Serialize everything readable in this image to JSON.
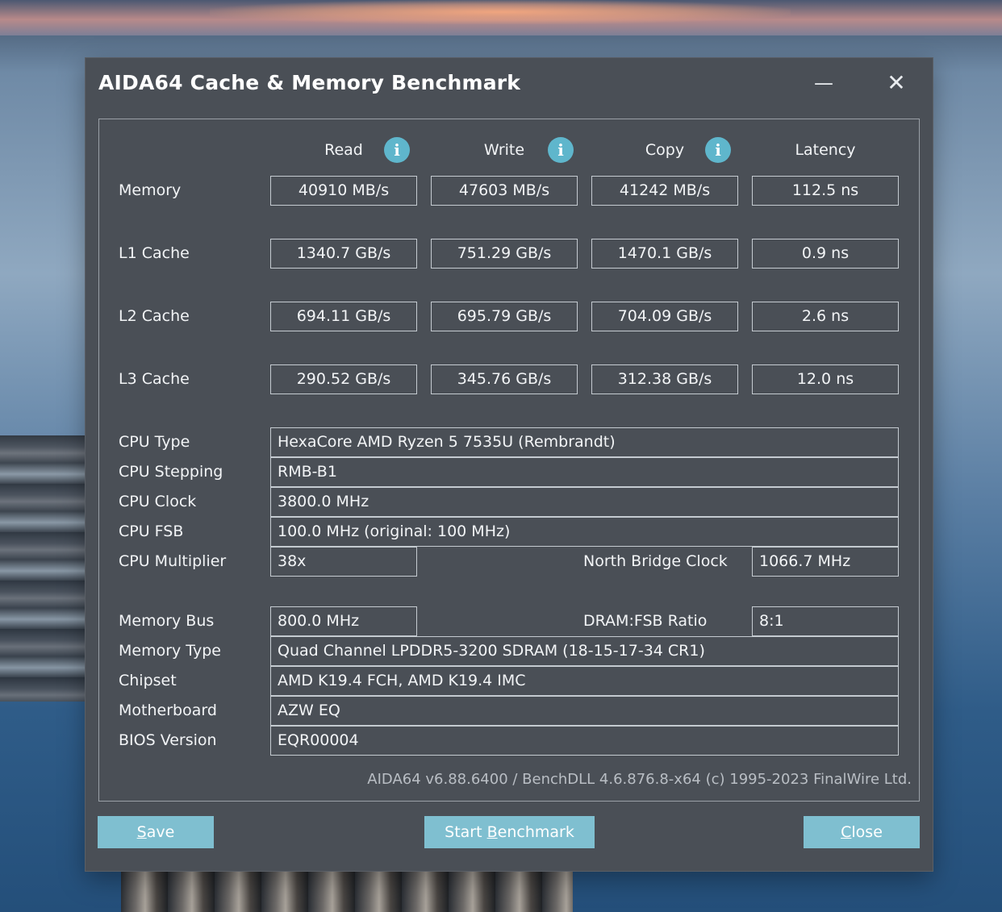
{
  "window": {
    "title": "AIDA64 Cache & Memory Benchmark",
    "minimize_glyph": "—",
    "close_glyph": "✕"
  },
  "columns": {
    "read": "Read",
    "write": "Write",
    "copy": "Copy",
    "latency": "Latency",
    "info_glyph": "i"
  },
  "rows": {
    "memory": {
      "label": "Memory",
      "read": "40910 MB/s",
      "write": "47603 MB/s",
      "copy": "41242 MB/s",
      "latency": "112.5 ns"
    },
    "l1": {
      "label": "L1 Cache",
      "read": "1340.7 GB/s",
      "write": "751.29 GB/s",
      "copy": "1470.1 GB/s",
      "latency": "0.9 ns"
    },
    "l2": {
      "label": "L2 Cache",
      "read": "694.11 GB/s",
      "write": "695.79 GB/s",
      "copy": "704.09 GB/s",
      "latency": "2.6 ns"
    },
    "l3": {
      "label": "L3 Cache",
      "read": "290.52 GB/s",
      "write": "345.76 GB/s",
      "copy": "312.38 GB/s",
      "latency": "12.0 ns"
    }
  },
  "info": {
    "cpu_type": {
      "label": "CPU Type",
      "value": "HexaCore AMD Ryzen 5 7535U  (Rembrandt)"
    },
    "cpu_stepping": {
      "label": "CPU Stepping",
      "value": "RMB-B1"
    },
    "cpu_clock": {
      "label": "CPU Clock",
      "value": "3800.0 MHz"
    },
    "cpu_fsb": {
      "label": "CPU FSB",
      "value": "100.0 MHz  (original: 100 MHz)"
    },
    "cpu_multiplier": {
      "label": "CPU Multiplier",
      "value": "38x"
    },
    "nb_clock": {
      "label": "North Bridge Clock",
      "value": "1066.7 MHz"
    },
    "memory_bus": {
      "label": "Memory Bus",
      "value": "800.0 MHz"
    },
    "dram_fsb": {
      "label": "DRAM:FSB Ratio",
      "value": "8:1"
    },
    "memory_type": {
      "label": "Memory Type",
      "value": "Quad Channel LPDDR5-3200 SDRAM  (18-15-17-34 CR1)"
    },
    "chipset": {
      "label": "Chipset",
      "value": "AMD K19.4 FCH, AMD K19.4 IMC"
    },
    "motherboard": {
      "label": "Motherboard",
      "value": "AZW EQ"
    },
    "bios": {
      "label": "BIOS Version",
      "value": "EQR00004"
    }
  },
  "footer": {
    "credit": "AIDA64 v6.88.6400 / BenchDLL 4.6.876.8-x64  (c) 1995-2023 FinalWire Ltd."
  },
  "buttons": {
    "save": {
      "pre": "",
      "key": "S",
      "post": "ave"
    },
    "start": {
      "pre": "Start ",
      "key": "B",
      "post": "enchmark"
    },
    "close": {
      "pre": "",
      "key": "C",
      "post": "lose"
    }
  },
  "colors": {
    "window_bg": "#4a4f56",
    "button_bg": "#7fbfd0",
    "info_icon": "#5fb6cc"
  }
}
